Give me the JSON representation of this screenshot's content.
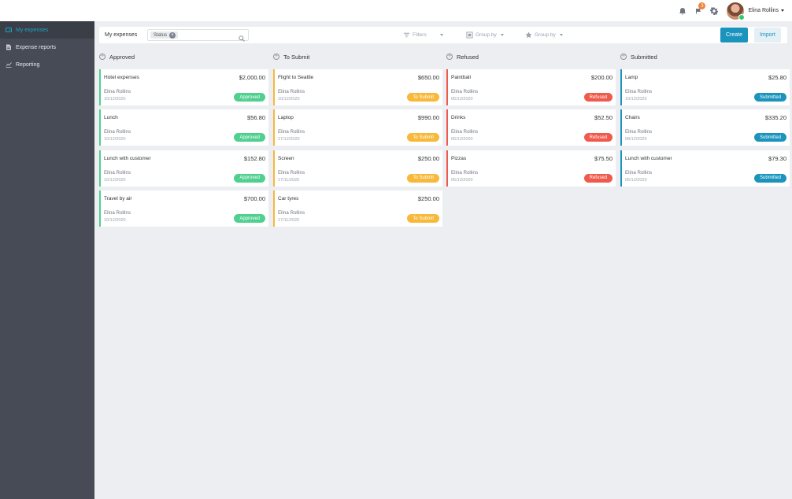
{
  "header": {
    "notifications_count": "3",
    "user_name": "Elina Rollins"
  },
  "sidebar": {
    "items": [
      {
        "label": "My expenses",
        "icon": "wallet-icon",
        "active": true
      },
      {
        "label": "Expense reports",
        "icon": "report-icon",
        "active": false
      },
      {
        "label": "Reporting",
        "icon": "chart-icon",
        "active": false
      }
    ]
  },
  "controlbar": {
    "title": "My expenses",
    "filter_chip": "Status",
    "filters_label": "Filters",
    "groupby1_label": "Group by",
    "groupby2_label": "Group by",
    "create_label": "Create",
    "import_label": "Import"
  },
  "colors": {
    "approved": "#4fd08f",
    "to_submit": "#f8b83a",
    "refused": "#ef5a4c",
    "submitted": "#1a94bd",
    "sidebar_bg": "#464b55",
    "accent": "#1aa3c6"
  },
  "columns": [
    {
      "title": "Approved",
      "status": "Approved",
      "color": "#4fd08f",
      "cards": [
        {
          "title": "Hotel expenses",
          "amount": "$2,000.00",
          "person": "Elina Rollins",
          "date": "10/12/2020"
        },
        {
          "title": "Lunch",
          "amount": "$56.80",
          "person": "Elina Rollins",
          "date": "10/12/2020"
        },
        {
          "title": "Lunch with customer",
          "amount": "$152.80",
          "person": "Elina Rollins",
          "date": "10/12/2020"
        },
        {
          "title": "Travel by air",
          "amount": "$700.00",
          "person": "Elina Rollins",
          "date": "10/12/2020"
        }
      ]
    },
    {
      "title": "To Submit",
      "status": "To Submit",
      "color": "#f8b83a",
      "cards": [
        {
          "title": "Flight to Seattle",
          "amount": "$650.00",
          "person": "Elina Rollins",
          "date": "10/12/2020"
        },
        {
          "title": "Laptop",
          "amount": "$990.00",
          "person": "Elina Rollins",
          "date": "17/12/2020"
        },
        {
          "title": "Screen",
          "amount": "$250.00",
          "person": "Elina Rollins",
          "date": "17/11/2020"
        },
        {
          "title": "Car tyres",
          "amount": "$250.00",
          "person": "Elina Rollins",
          "date": "17/11/2020"
        }
      ]
    },
    {
      "title": "Refused",
      "status": "Refused",
      "color": "#ef5a4c",
      "cards": [
        {
          "title": "Paintball",
          "amount": "$200.00",
          "person": "Elina Rollins",
          "date": "05/12/2020"
        },
        {
          "title": "Drinks",
          "amount": "$52.50",
          "person": "Elina Rollins",
          "date": "05/12/2020"
        },
        {
          "title": "Pizzas",
          "amount": "$75.50",
          "person": "Elina Rollins",
          "date": "05/12/2020"
        }
      ]
    },
    {
      "title": "Submitted",
      "status": "Submitted",
      "color": "#1a94bd",
      "cards": [
        {
          "title": "Lamp",
          "amount": "$25.80",
          "person": "Elina Rollins",
          "date": "10/12/2020"
        },
        {
          "title": "Chairs",
          "amount": "$335.20",
          "person": "Elina Rollins",
          "date": "08/12/2020"
        },
        {
          "title": "Lunch with customer",
          "amount": "$79.30",
          "person": "Elina Rollins",
          "date": "05/12/2020"
        }
      ]
    }
  ]
}
